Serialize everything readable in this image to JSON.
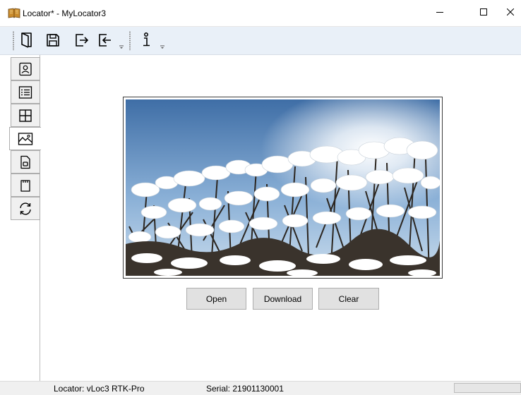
{
  "window": {
    "title": "Locator* - MyLocator3",
    "app_icon": "locator-book-icon",
    "controls": [
      "minimize-icon",
      "maximize-icon",
      "close-icon"
    ]
  },
  "toolbar": {
    "buttons": [
      {
        "name": "open-locator",
        "icon": "open-book-icon"
      },
      {
        "name": "save",
        "icon": "save-disk-icon"
      },
      {
        "name": "export",
        "icon": "export-arrow-icon"
      },
      {
        "name": "import",
        "icon": "import-arrow-icon"
      },
      {
        "name": "info",
        "icon": "info-icon"
      }
    ]
  },
  "side_tabs": [
    {
      "name": "contact",
      "icon": "contact-card-icon"
    },
    {
      "name": "list",
      "icon": "list-view-icon"
    },
    {
      "name": "grid",
      "icon": "grid-icon"
    },
    {
      "name": "image",
      "icon": "image-icon",
      "active": true
    },
    {
      "name": "document",
      "icon": "document-icon"
    },
    {
      "name": "sd-card",
      "icon": "sd-card-icon"
    },
    {
      "name": "sync",
      "icon": "sync-icon"
    }
  ],
  "image_panel": {
    "image_subject": "snow-covered-shrubs-photo",
    "buttons": {
      "open": "Open",
      "download": "Download",
      "clear": "Clear"
    }
  },
  "status": {
    "locator": "Locator:  vLoc3  RTK-Pro",
    "serial": "Serial:  21901130001"
  },
  "colors": {
    "toolbar_bg": "#e9f0f8",
    "button_bg": "#e1e1e1",
    "status_bg": "#f0f0f0"
  }
}
